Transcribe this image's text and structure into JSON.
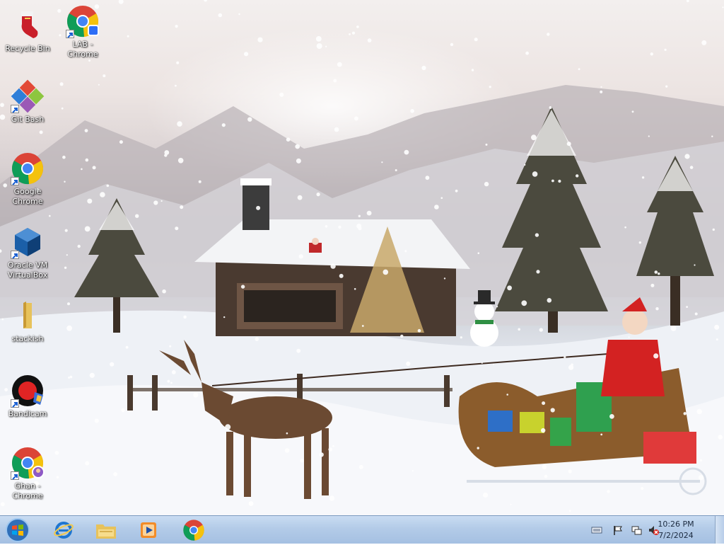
{
  "desktop": {
    "icons": [
      {
        "name": "recycle-bin",
        "label": "Recycle Bin",
        "icon": "stocking-icon"
      },
      {
        "name": "lab-chrome",
        "label": "LAB -\nChrome",
        "icon": "chrome-profile-icon"
      },
      {
        "name": "git-bash",
        "label": "Git Bash",
        "icon": "git-bash-icon"
      },
      {
        "name": "google-chrome",
        "label": "Google\nChrome",
        "icon": "chrome-icon"
      },
      {
        "name": "oracle-vm-virtualbox",
        "label": "Oracle VM\nVirtualBox",
        "icon": "virtualbox-icon"
      },
      {
        "name": "stackish",
        "label": "stackish",
        "icon": "folder-icon"
      },
      {
        "name": "bandicam",
        "label": "Bandicam",
        "icon": "bandicam-icon"
      },
      {
        "name": "ghan-chrome",
        "label": "Ghan -\nChrome",
        "icon": "chrome-profile-icon"
      }
    ]
  },
  "taskbar": {
    "start": "windows-start-icon",
    "pinned": [
      {
        "name": "internet-explorer",
        "icon": "internet-explorer-icon"
      },
      {
        "name": "windows-explorer",
        "icon": "folder-icon"
      },
      {
        "name": "media-player",
        "icon": "media-player-icon"
      },
      {
        "name": "google-chrome",
        "icon": "chrome-icon"
      }
    ],
    "tray": {
      "icons": [
        "keyboard-icon",
        "action-center-flag-icon",
        "network-icon",
        "volume-muted-icon"
      ],
      "time": "10:26 PM",
      "date": "7/2/2024"
    }
  },
  "colors": {
    "taskbar": "#b3cbe8",
    "chrome_red": "#db4437",
    "chrome_yellow": "#f4c20d",
    "chrome_green": "#0f9d58",
    "chrome_blue": "#4285f4"
  }
}
